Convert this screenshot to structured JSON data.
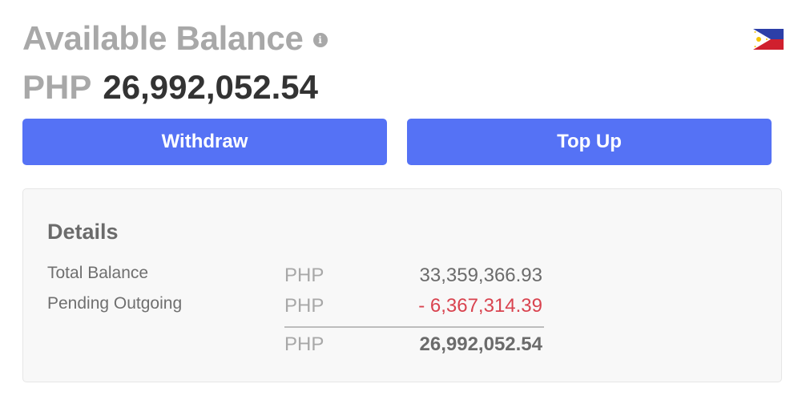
{
  "header": {
    "title": "Available Balance",
    "info_icon": "info-icon",
    "flag_icon": "philippines-flag-icon"
  },
  "balance": {
    "currency": "PHP",
    "amount": "26,992,052.54"
  },
  "actions": {
    "withdraw_label": "Withdraw",
    "topup_label": "Top Up"
  },
  "details": {
    "title": "Details",
    "rows": [
      {
        "label": "Total Balance",
        "currency": "PHP",
        "amount": "33,359,366.93"
      },
      {
        "label": "Pending Outgoing",
        "currency": "PHP",
        "amount": "- 6,367,314.39"
      }
    ],
    "total": {
      "currency": "PHP",
      "amount": "26,992,052.54"
    }
  },
  "colors": {
    "accent": "#5572f5",
    "negative": "#d9434f",
    "muted": "#a8a8a8"
  }
}
